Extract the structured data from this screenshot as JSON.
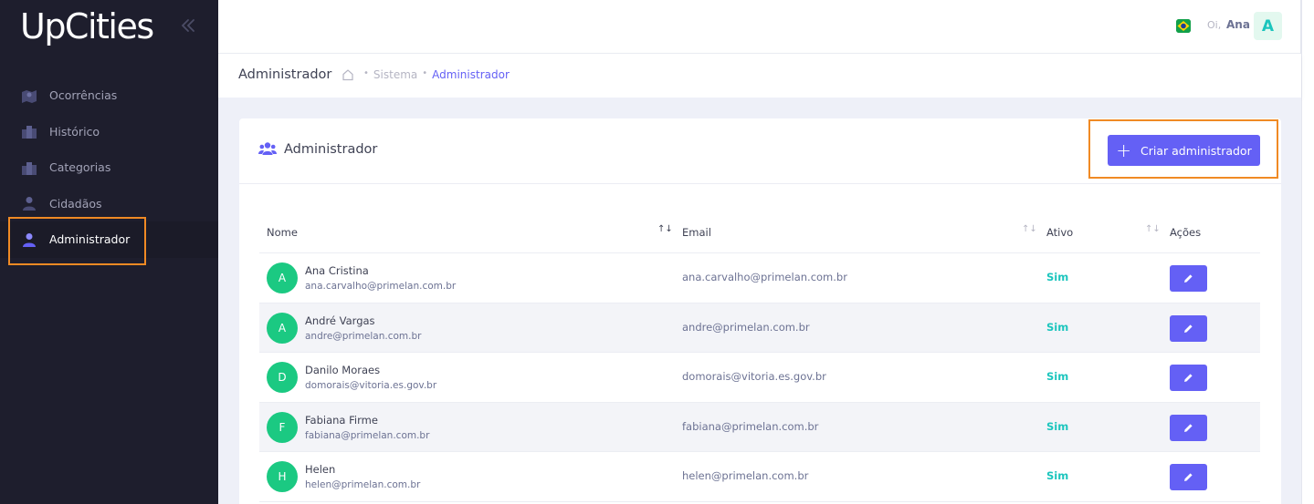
{
  "app": {
    "logo": "UpCities"
  },
  "sidebar": {
    "items": [
      {
        "label": "Ocorrências",
        "icon": "map-icon"
      },
      {
        "label": "Histórico",
        "icon": "city-icon"
      },
      {
        "label": "Categorias",
        "icon": "city-icon"
      },
      {
        "label": "Cidadãos",
        "icon": "user-icon"
      },
      {
        "label": "Administrador",
        "icon": "user-icon",
        "active": true
      }
    ]
  },
  "header": {
    "greeting": "Oi,",
    "user_name": "Ana",
    "user_initial": "A",
    "flag": "brazil-flag-icon"
  },
  "subheader": {
    "title": "Administrador",
    "breadcrumb": [
      "Sistema",
      "Administrador"
    ]
  },
  "card": {
    "title": "Administrador",
    "create_button": "Criar administrador"
  },
  "table": {
    "columns": [
      "Nome",
      "Email",
      "Ativo",
      "Ações"
    ],
    "rows": [
      {
        "initial": "A",
        "name": "Ana Cristina",
        "sub_email": "ana.carvalho@primelan.com.br",
        "email": "ana.carvalho@primelan.com.br",
        "active": "Sim"
      },
      {
        "initial": "A",
        "name": "André Vargas",
        "sub_email": "andre@primelan.com.br",
        "email": "andre@primelan.com.br",
        "active": "Sim"
      },
      {
        "initial": "D",
        "name": "Danilo Moraes",
        "sub_email": "domorais@vitoria.es.gov.br",
        "email": "domorais@vitoria.es.gov.br",
        "active": "Sim"
      },
      {
        "initial": "F",
        "name": "Fabiana Firme",
        "sub_email": "fabiana@primelan.com.br",
        "email": "fabiana@primelan.com.br",
        "active": "Sim"
      },
      {
        "initial": "H",
        "name": "Helen",
        "sub_email": "helen@primelan.com.br",
        "email": "helen@primelan.com.br",
        "active": "Sim"
      }
    ]
  },
  "colors": {
    "accent": "#6460f5",
    "sidebar": "#1e1e2d",
    "success": "#1bc5bd",
    "avatar": "#1bc982",
    "highlight": "#f08a24"
  }
}
